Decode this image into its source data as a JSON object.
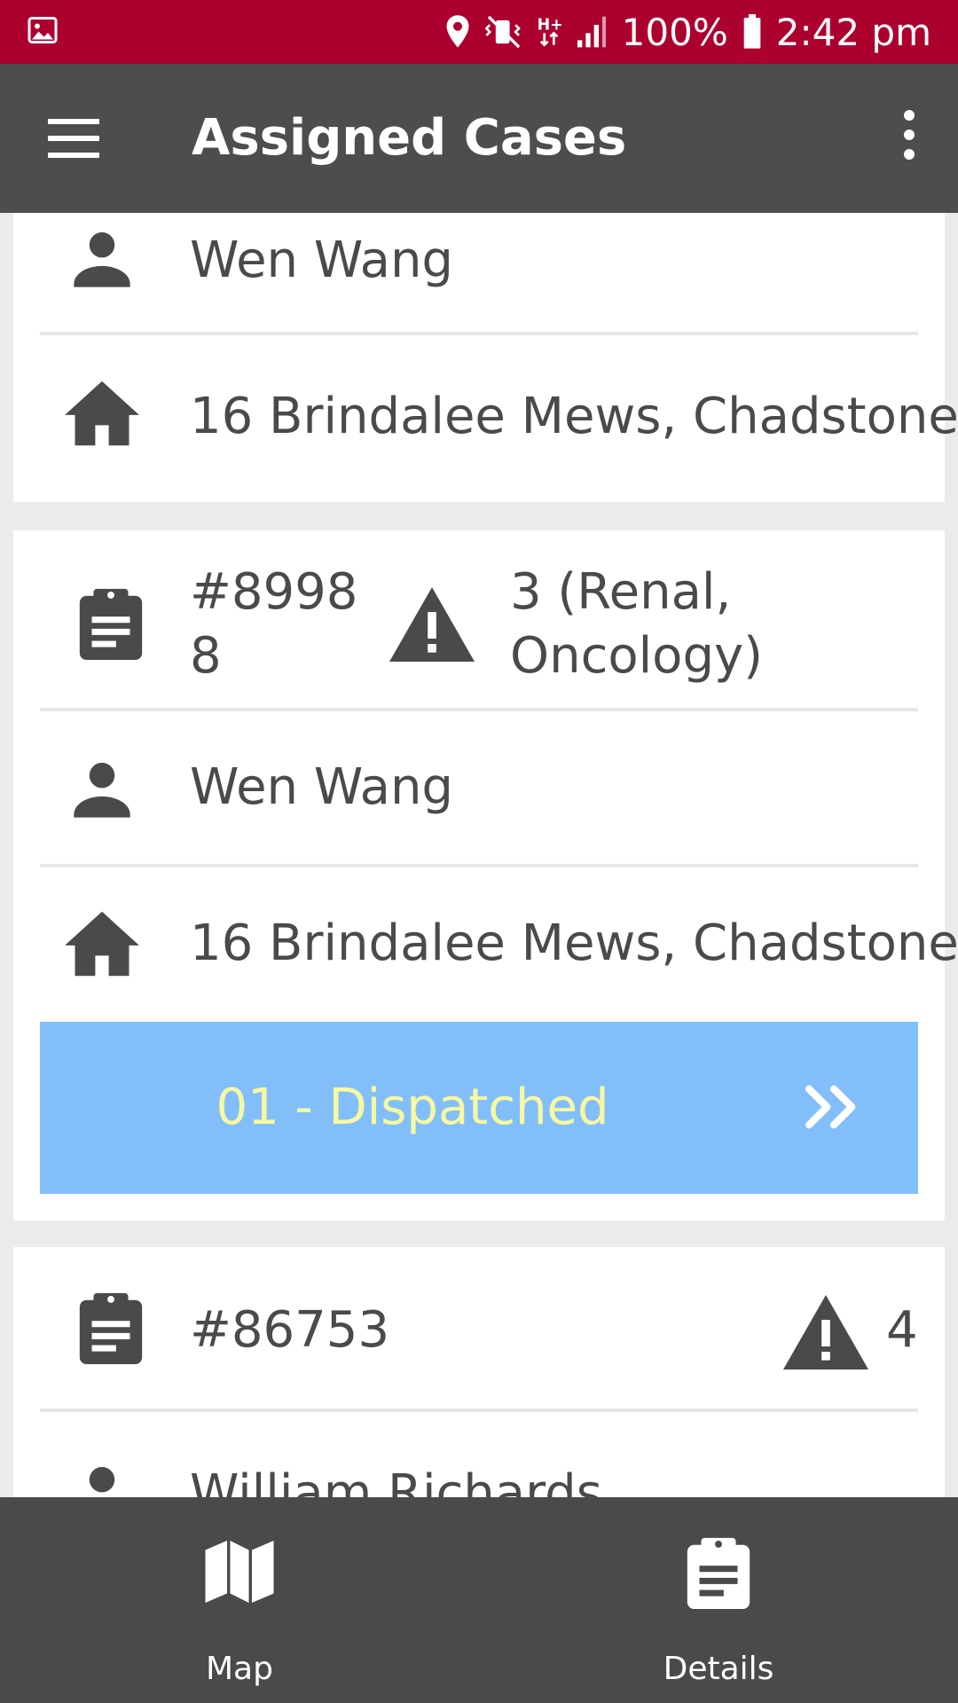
{
  "status_bar": {
    "battery": "100%",
    "time": "2:42 pm",
    "icons": [
      "gallery-icon",
      "location-icon",
      "vibrate-icon",
      "network-hplus-icon",
      "signal-icon",
      "battery-icon"
    ]
  },
  "app_bar": {
    "title": "Assigned Cases"
  },
  "cases": [
    {
      "patient": "Wen Wang",
      "address": "16 Brindalee Mews, Chadstone"
    },
    {
      "case_number_line1": "#8998",
      "case_number_line2": "8",
      "priority_line1": "3 (Renal,",
      "priority_line2": "Oncology)",
      "patient": "Wen Wang",
      "address": "16 Brindalee Mews, Chadstone",
      "status": "01 - Dispatched"
    },
    {
      "case_number": "#86753",
      "priority": "4",
      "patient": "William Richards"
    }
  ],
  "colors": {
    "status_bar": "#ac002f",
    "app_bar": "#4d4d4d",
    "dispatch_bg": "#82bffa",
    "dispatch_text": "#f8f8a0",
    "bottom_nav": "#4a4a4a"
  },
  "bottom_nav": {
    "map_label": "Map",
    "details_label": "Details"
  }
}
